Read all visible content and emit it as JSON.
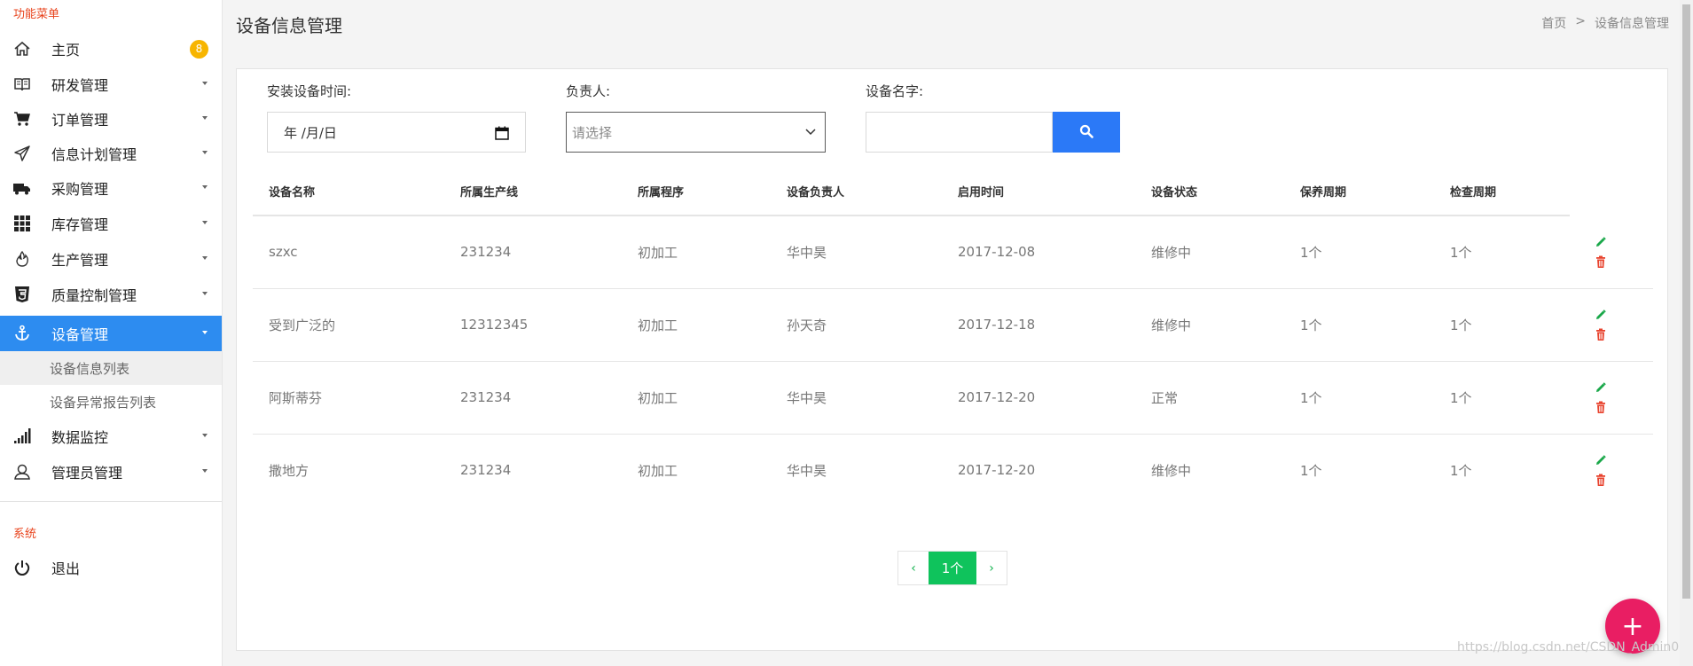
{
  "sidebar": {
    "section_menu": "功能菜单",
    "section_system": "系统",
    "items": [
      {
        "label": "主页",
        "badge": "8",
        "icon": "home-icon"
      },
      {
        "label": "研发管理",
        "icon": "book-icon"
      },
      {
        "label": "订单管理",
        "icon": "cart-icon"
      },
      {
        "label": "信息计划管理",
        "icon": "paper-plane-icon"
      },
      {
        "label": "采购管理",
        "icon": "truck-icon"
      },
      {
        "label": "库存管理",
        "icon": "grid-icon"
      },
      {
        "label": "生产管理",
        "icon": "fire-icon"
      },
      {
        "label": "质量控制管理",
        "icon": "html5-shield-icon"
      },
      {
        "label": "设备管理",
        "icon": "anchor-icon",
        "active": true
      },
      {
        "label": "数据监控",
        "icon": "signal-icon"
      },
      {
        "label": "管理员管理",
        "icon": "user-icon"
      }
    ],
    "subitems": [
      {
        "label": "设备信息列表",
        "selected": true
      },
      {
        "label": "设备异常报告列表"
      }
    ],
    "logout": {
      "label": "退出",
      "icon": "power-icon"
    }
  },
  "header": {
    "title": "设备信息管理",
    "breadcrumb": [
      "首页",
      "设备信息管理"
    ],
    "breadcrumb_sep": ">"
  },
  "filters": {
    "install_time_label": "安装设备时间:",
    "install_time_value": "年 /月/日",
    "owner_label": "负责人:",
    "owner_placeholder": "请选择",
    "device_name_label": "设备名字:"
  },
  "table": {
    "columns": [
      "设备名称",
      "所属生产线",
      "所属程序",
      "设备负责人",
      "启用时间",
      "设备状态",
      "保养周期",
      "检查周期"
    ],
    "rows": [
      [
        "szxc",
        "231234",
        "初加工",
        "华中昊",
        "2017-12-08",
        "维修中",
        "1个",
        "1个"
      ],
      [
        "受到广泛的",
        "12312345",
        "初加工",
        "孙天奇",
        "2017-12-18",
        "维修中",
        "1个",
        "1个"
      ],
      [
        "阿斯蒂芬",
        "231234",
        "初加工",
        "华中昊",
        "2017-12-20",
        "正常",
        "1个",
        "1个"
      ],
      [
        "撒地方",
        "231234",
        "初加工",
        "华中昊",
        "2017-12-20",
        "维修中",
        "1个",
        "1个"
      ]
    ]
  },
  "pagination": {
    "prev": "‹",
    "current": "1个",
    "next": "›"
  },
  "fab": {
    "label": "+"
  },
  "watermark": "https://blog.csdn.net/CSDN_Admin0",
  "colors": {
    "accent": "#2d8cf0",
    "search": "#2b79f7",
    "pager": "#0fc35c",
    "fab": "#e91e63",
    "badge": "#f7b500",
    "section": "#e8431c",
    "edit": "#1aa84a",
    "delete": "#e8432e"
  }
}
